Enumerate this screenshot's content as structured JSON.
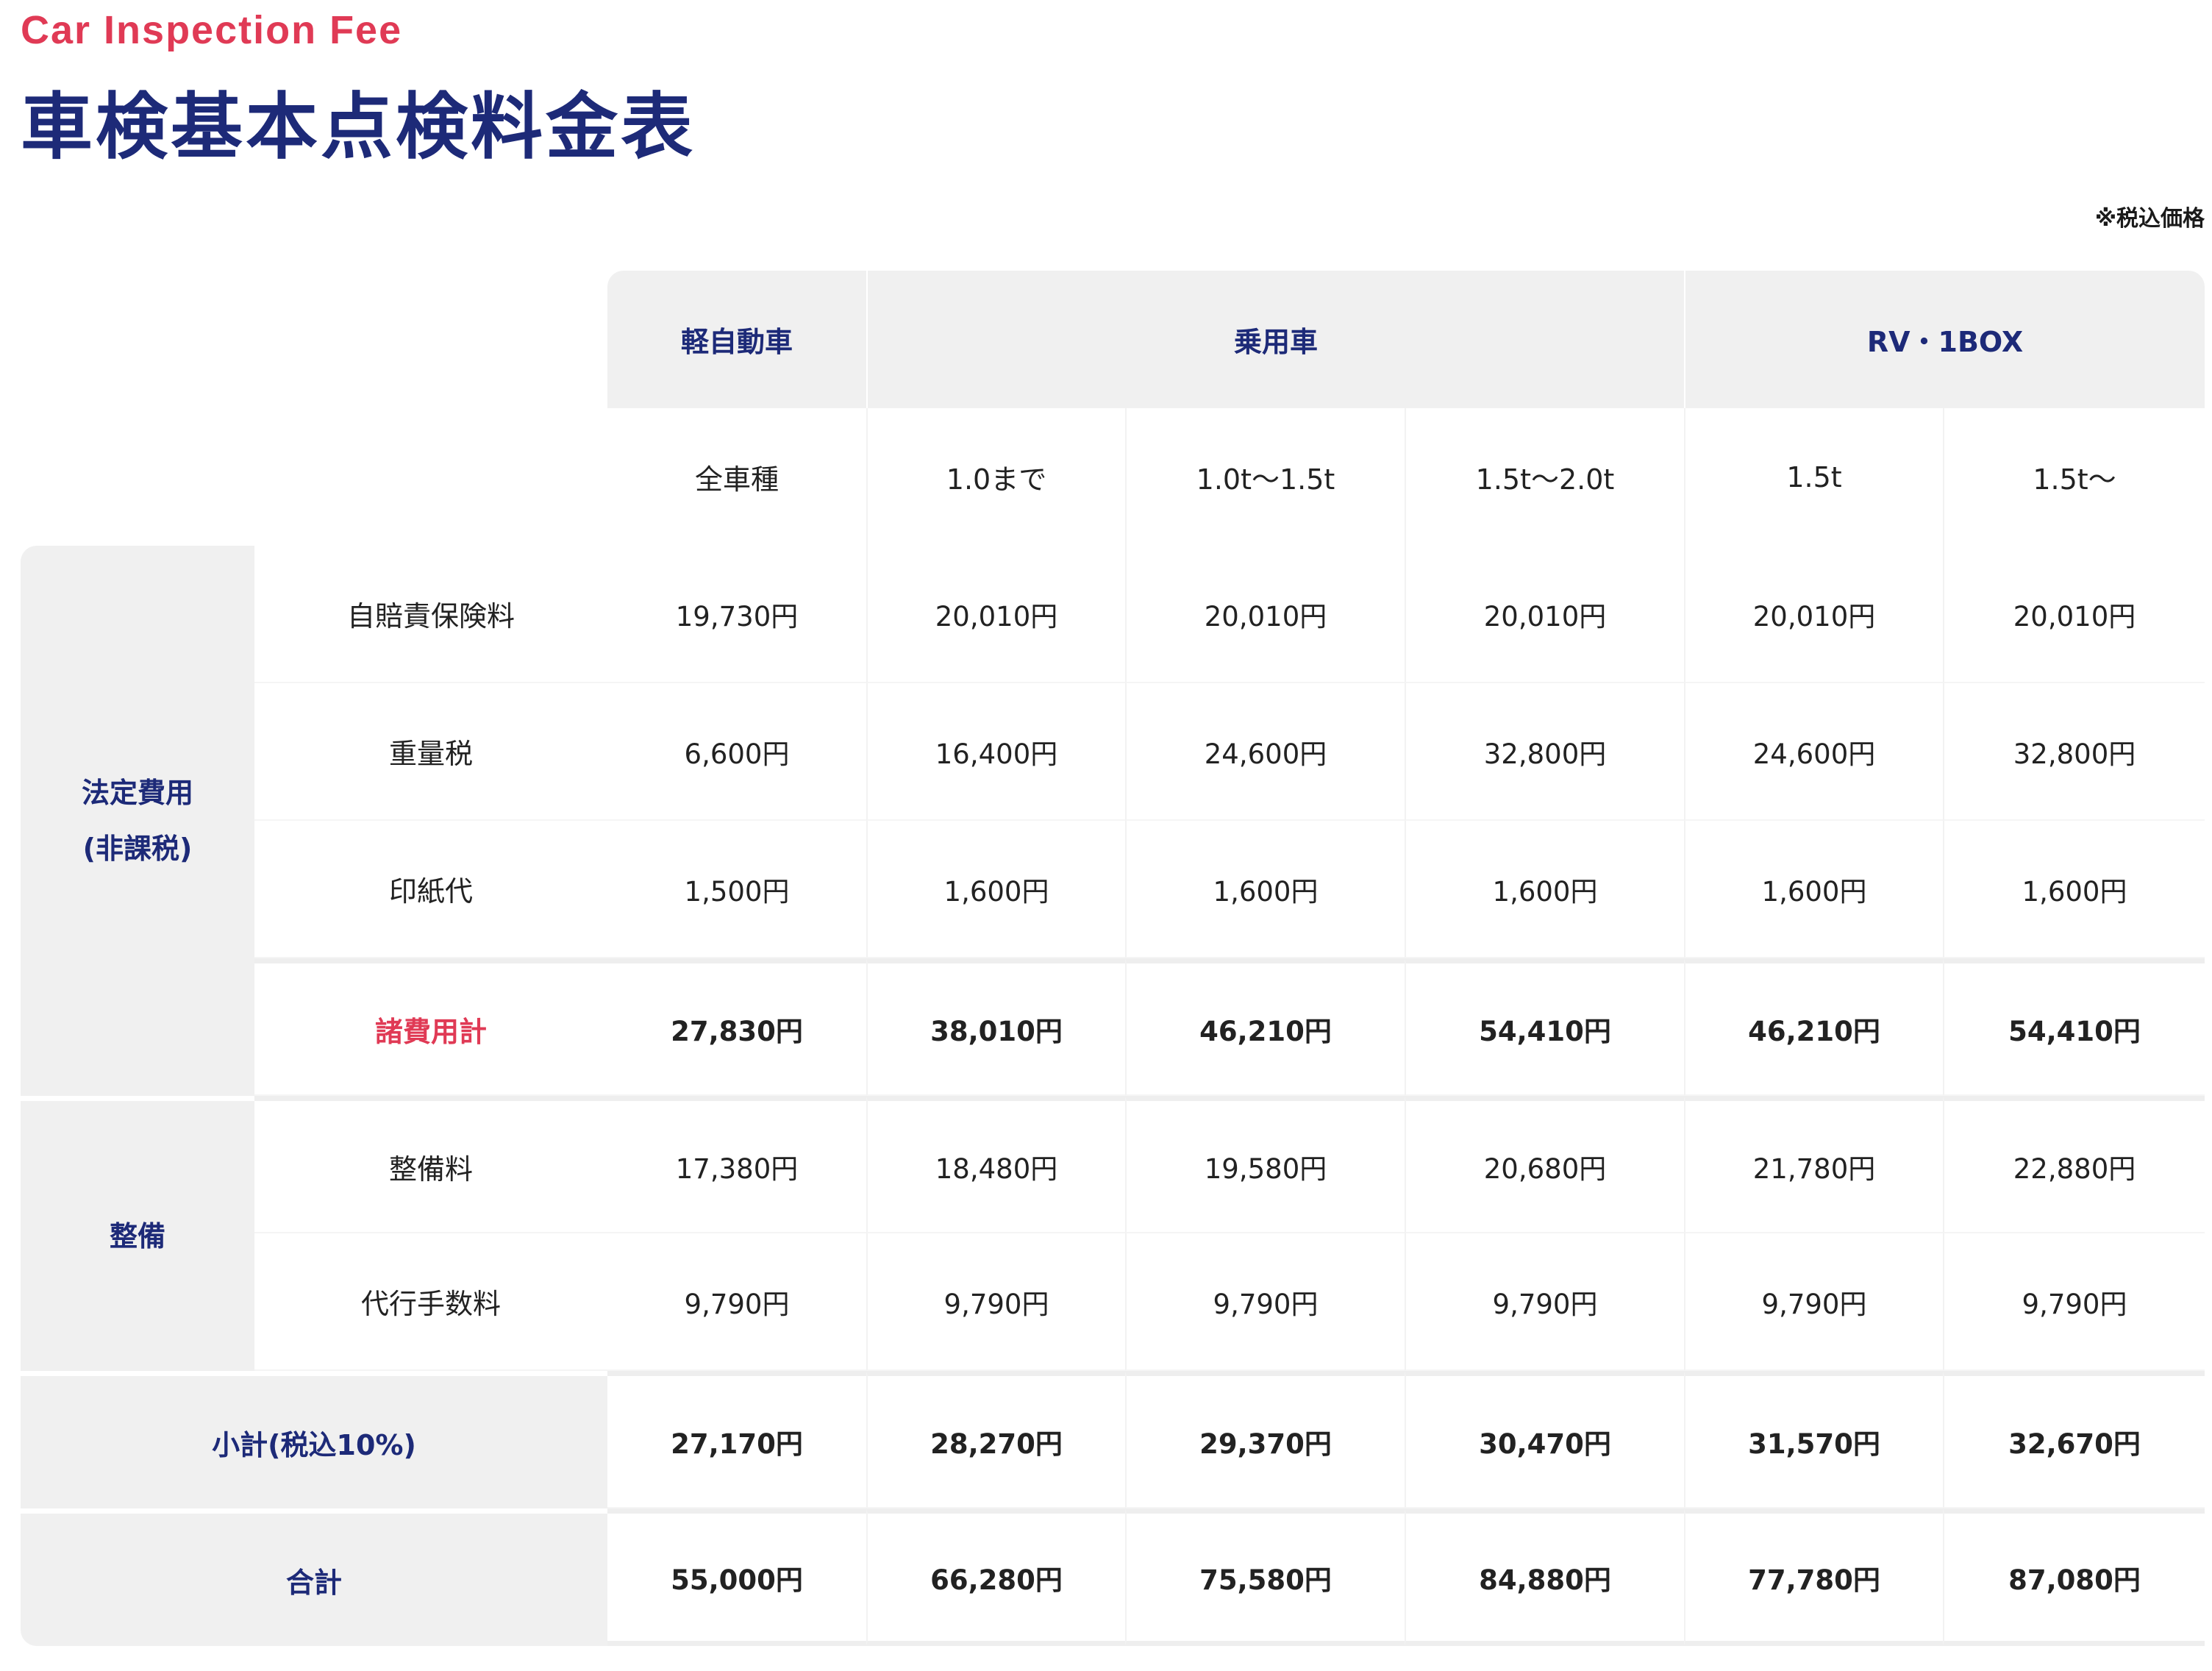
{
  "header": {
    "eyebrow": "Car Inspection Fee",
    "title": "車検基本点検料金表",
    "tax_note": "※税込価格"
  },
  "table": {
    "groups": [
      "軽自動車",
      "乗用車",
      "RV・1BOX"
    ],
    "subheads": [
      "全車種",
      "1.0まで",
      "1.0t〜1.5t",
      "1.5t〜2.0t",
      "1.5t",
      "1.5t〜"
    ],
    "legal": {
      "label_line1": "法定費用",
      "label_line2": "(非課税)",
      "rows": [
        {
          "label": "自賠責保険料",
          "values": [
            "19,730円",
            "20,010円",
            "20,010円",
            "20,010円",
            "20,010円",
            "20,010円"
          ]
        },
        {
          "label": "重量税",
          "values": [
            "6,600円",
            "16,400円",
            "24,600円",
            "32,800円",
            "24,600円",
            "32,800円"
          ]
        },
        {
          "label": "印紙代",
          "values": [
            "1,500円",
            "1,600円",
            "1,600円",
            "1,600円",
            "1,600円",
            "1,600円"
          ]
        }
      ],
      "subtotal": {
        "label": "諸費用計",
        "values": [
          "27,830円",
          "38,010円",
          "46,210円",
          "54,410円",
          "46,210円",
          "54,410円"
        ]
      }
    },
    "maintenance": {
      "label": "整備",
      "rows": [
        {
          "label": "整備料",
          "values": [
            "17,380円",
            "18,480円",
            "19,580円",
            "20,680円",
            "21,780円",
            "22,880円"
          ]
        },
        {
          "label": "代行手数料",
          "values": [
            "9,790円",
            "9,790円",
            "9,790円",
            "9,790円",
            "9,790円",
            "9,790円"
          ]
        }
      ]
    },
    "subtotal_tax": {
      "label": "小計(税込10%)",
      "values": [
        "27,170円",
        "28,270円",
        "29,370円",
        "30,470円",
        "31,570円",
        "32,670円"
      ]
    },
    "total": {
      "label": "合計",
      "values": [
        "55,000円",
        "66,280円",
        "75,580円",
        "84,880円",
        "77,780円",
        "87,080円"
      ]
    }
  },
  "colors": {
    "accent_red": "#e03a55",
    "navy": "#1d2a78",
    "panel_gray": "#f0f0f0"
  }
}
